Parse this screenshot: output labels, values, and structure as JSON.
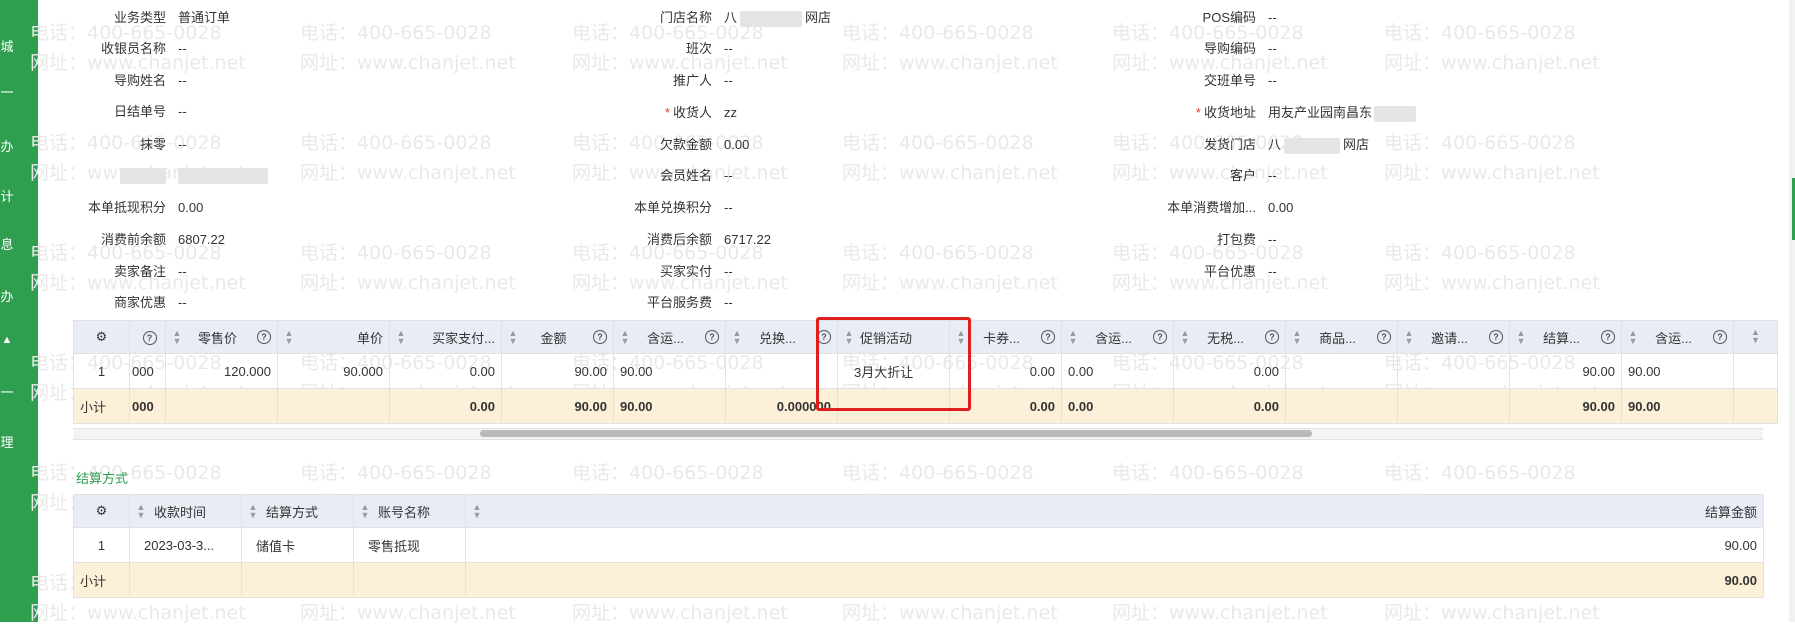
{
  "sidebar_glyphs": [
    "城",
    "一",
    "办",
    "计",
    "息",
    "办",
    "▲",
    "一",
    "理"
  ],
  "watermark": {
    "phone": "电话：400-665-0028",
    "site": "网址：www.chanjet.net"
  },
  "fields": {
    "business_type": {
      "label": "业务类型",
      "value": "普通订单"
    },
    "store_name": {
      "label": "门店名称",
      "value_prefix": "八",
      "value_suffix": "网店"
    },
    "pos_code": {
      "label": "POS编码",
      "value": "--"
    },
    "cashier_name": {
      "label": "收银员名称",
      "value": "--"
    },
    "shift": {
      "label": "班次",
      "value": "--"
    },
    "guide_code": {
      "label": "导购编码",
      "value": "--"
    },
    "guide_name": {
      "label": "导购姓名",
      "value": "--"
    },
    "promoter": {
      "label": "推广人",
      "value": "--"
    },
    "handover_no": {
      "label": "交班单号",
      "value": "--"
    },
    "daily_no": {
      "label": "日结单号",
      "value": "--"
    },
    "receiver": {
      "label": "收货人",
      "value": "zz"
    },
    "receiver_addr": {
      "label": "收货地址",
      "value": "用友产业园南昌东"
    },
    "round_off": {
      "label": "抹零",
      "value": "--"
    },
    "owed_amount": {
      "label": "欠款金额",
      "value": "0.00"
    },
    "ship_store": {
      "label": "发货门店",
      "value_prefix": "八",
      "value_suffix": "网店"
    },
    "member_name": {
      "label": "会员姓名",
      "value": "--"
    },
    "customer": {
      "label": "客户",
      "value": "--"
    },
    "cash_points": {
      "label": "本单抵现积分",
      "value": "0.00"
    },
    "exchange_points": {
      "label": "本单兑换积分",
      "value": "--"
    },
    "consume_points": {
      "label": "本单消费增加...",
      "value": "0.00"
    },
    "balance_before": {
      "label": "消费前余额",
      "value": "6807.22"
    },
    "balance_after": {
      "label": "消费后余额",
      "value": "6717.22"
    },
    "packing_fee": {
      "label": "打包费",
      "value": "--"
    },
    "seller_note": {
      "label": "卖家备注",
      "value": "--"
    },
    "buyer_paid": {
      "label": "买家实付",
      "value": "--"
    },
    "platform_discount": {
      "label": "平台优惠",
      "value": "--"
    },
    "merchant_discount": {
      "label": "商家优惠",
      "value": "--"
    },
    "platform_fee": {
      "label": "平台服务费",
      "value": "--"
    }
  },
  "items_table": {
    "headers": [
      "零售价",
      "单价",
      "买家支付...",
      "金额",
      "含运...",
      "兑换...",
      "促销活动",
      "卡券...",
      "含运...",
      "无税...",
      "商品...",
      "邀请...",
      "结算...",
      "含运..."
    ],
    "row": {
      "index": "1",
      "c0": "000",
      "retail_price": "120.000",
      "unit_price": "90.000",
      "buyer_pay": "0.00",
      "amount": "90.00",
      "with_ship": "90.00",
      "exchange": "",
      "promo": "3月大折让",
      "coupon": "0.00",
      "with_ship2": "0.00",
      "tax_free": "0.00",
      "goods": "",
      "invite": "",
      "settle": "90.00",
      "with_ship3": "90.00"
    },
    "subtotal": {
      "label": "小计",
      "c0": "000",
      "buyer_pay": "0.00",
      "amount": "90.00",
      "with_ship": "90.00",
      "exchange": "0.000000",
      "coupon": "0.00",
      "with_ship2": "0.00",
      "tax_free": "0.00",
      "settle": "90.00",
      "with_ship3": "90.00"
    }
  },
  "settlement": {
    "title": "结算方式",
    "headers": {
      "time": "收款时间",
      "method": "结算方式",
      "account": "账号名称",
      "amount": "结算金额"
    },
    "row": {
      "index": "1",
      "time": "2023-03-3...",
      "method": "储值卡",
      "account": "零售抵现",
      "amount": "90.00"
    },
    "subtotal": {
      "label": "小计",
      "amount": "90.00"
    }
  },
  "icons": {
    "settings": "gear-icon",
    "help": "question-circle-icon",
    "sort": "sort-arrows-icon"
  }
}
